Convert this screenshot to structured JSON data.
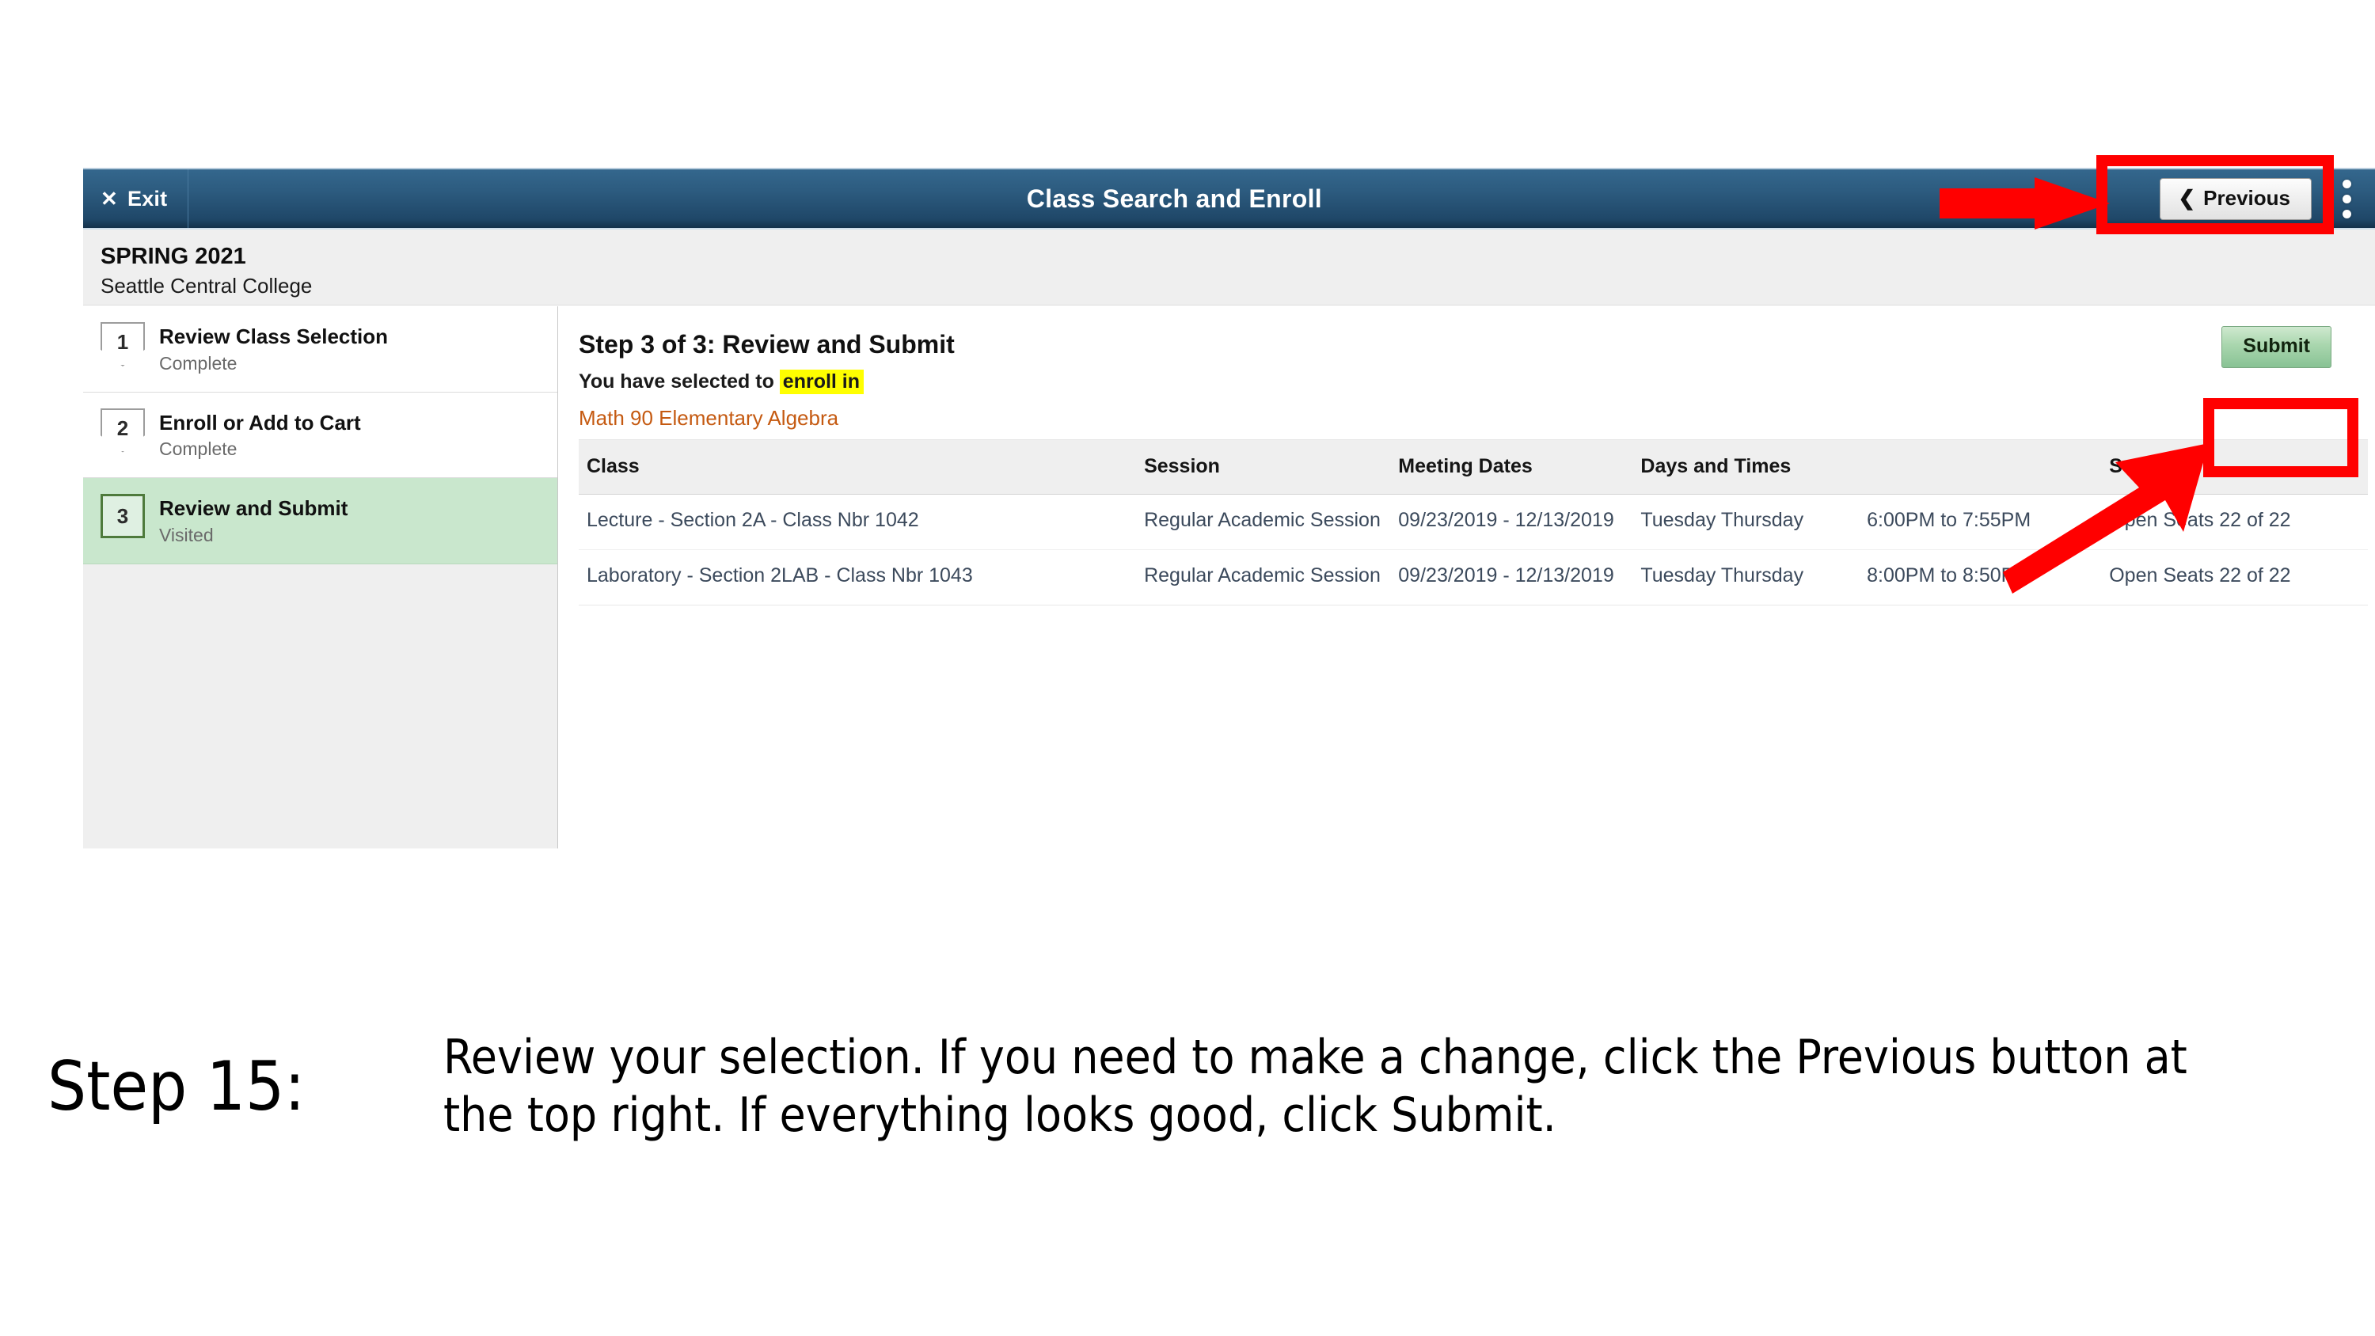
{
  "header": {
    "exit_label": "Exit",
    "exit_icon": "close-x-icon",
    "title": "Class Search and Enroll",
    "previous_label": "Previous",
    "previous_icon": "chevron-left-icon",
    "kebab_icon": "more-options-vertical-icon",
    "bar_color": "#2d5c80"
  },
  "term_band": {
    "term": "SPRING 2021",
    "institution": "Seattle Central College"
  },
  "sidebar": {
    "steps": [
      {
        "number": "1",
        "title": "Review Class Selection",
        "status": "Complete",
        "active": false
      },
      {
        "number": "2",
        "title": "Enroll or Add to Cart",
        "status": "Complete",
        "active": false
      },
      {
        "number": "3",
        "title": "Review and Submit",
        "status": "Visited",
        "active": true
      }
    ],
    "active_bg": "#c9e7cd"
  },
  "main": {
    "step_heading": "Step 3 of 3: Review and Submit",
    "selection_prefix": "You have selected to",
    "selection_highlight": "enroll in",
    "highlight_color": "#ffff00",
    "course": "Math 90  Elementary Algebra",
    "course_color": "#c55a11",
    "submit_label": "Submit",
    "submit_color": "#a9d6ae"
  },
  "table": {
    "columns": [
      "Class",
      "Session",
      "Meeting Dates",
      "Days and Times",
      "",
      "Seats"
    ],
    "rows": [
      {
        "class": "Lecture - Section 2A - Class Nbr 1042",
        "session": "Regular Academic Session",
        "meeting_dates": "09/23/2019 - 12/13/2019",
        "days": "Tuesday Thursday",
        "times": "6:00PM to 7:55PM",
        "seats": "Open Seats 22 of 22"
      },
      {
        "class": "Laboratory - Section 2LAB - Class Nbr 1043",
        "session": "Regular Academic Session",
        "meeting_dates": "09/23/2019 - 12/13/2019",
        "days": "Tuesday Thursday",
        "times": "8:00PM to 8:50PM",
        "seats": "Open Seats 22 of 22"
      }
    ]
  },
  "annotations": {
    "color": "#ff0000",
    "arrow_to_previous": "red-arrow-right-icon",
    "box_around_previous": "red-highlight-box",
    "arrow_to_submit": "red-arrow-up-right-icon",
    "box_around_submit": "red-highlight-box"
  },
  "caption": {
    "step_label": "Step 15:",
    "body": "Review your selection. If you need to make a change, click the Previous button at the top right. If everything looks good, click Submit."
  }
}
